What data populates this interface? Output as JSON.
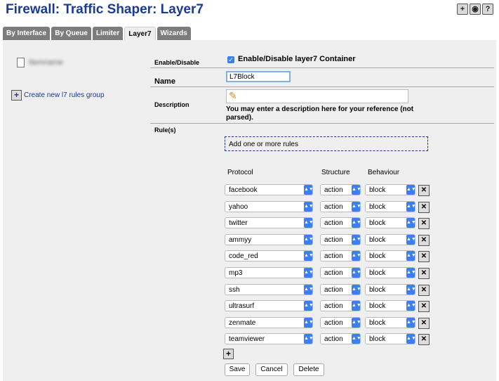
{
  "page": {
    "title": "Firewall: Traffic Shaper: Layer7"
  },
  "top_icons": [
    {
      "name": "add-icon",
      "glyph": "+"
    },
    {
      "name": "log-icon",
      "glyph": "◉"
    },
    {
      "name": "help-icon",
      "glyph": "?"
    }
  ],
  "tabs": [
    {
      "label": "By Interface",
      "active": false
    },
    {
      "label": "By Queue",
      "active": false
    },
    {
      "label": "Limiter",
      "active": false
    },
    {
      "label": "Layer7",
      "active": true
    },
    {
      "label": "Wizards",
      "active": false
    }
  ],
  "left": {
    "tree_item_label": "Itemname",
    "create_link": "Create new l7 rules group"
  },
  "form": {
    "enable_label": "Enable/Disable",
    "enable_checkbox_label": "Enable/Disable layer7 Container",
    "name_label": "Name",
    "name_value": "L7Block",
    "description_label": "Description",
    "description_note": "You may enter a description here for your reference (not parsed).",
    "rules_label": "Rule(s)",
    "add_rules_text": "Add one or more rules",
    "col_protocol": "Protocol",
    "col_structure": "Structure",
    "col_behaviour": "Behaviour",
    "rules": [
      {
        "protocol": "facebook",
        "structure": "action",
        "behaviour": "block"
      },
      {
        "protocol": "yahoo",
        "structure": "action",
        "behaviour": "block"
      },
      {
        "protocol": "twitter",
        "structure": "action",
        "behaviour": "block"
      },
      {
        "protocol": "ammyy",
        "structure": "action",
        "behaviour": "block"
      },
      {
        "protocol": "code_red",
        "structure": "action",
        "behaviour": "block"
      },
      {
        "protocol": "mp3",
        "structure": "action",
        "behaviour": "block"
      },
      {
        "protocol": "ssh",
        "structure": "action",
        "behaviour": "block"
      },
      {
        "protocol": "ultrasurf",
        "structure": "action",
        "behaviour": "block"
      },
      {
        "protocol": "zenmate",
        "structure": "action",
        "behaviour": "block"
      },
      {
        "protocol": "teamviewer",
        "structure": "action",
        "behaviour": "block"
      }
    ]
  },
  "buttons": {
    "save": "Save",
    "cancel": "Cancel",
    "delete": "Delete"
  }
}
